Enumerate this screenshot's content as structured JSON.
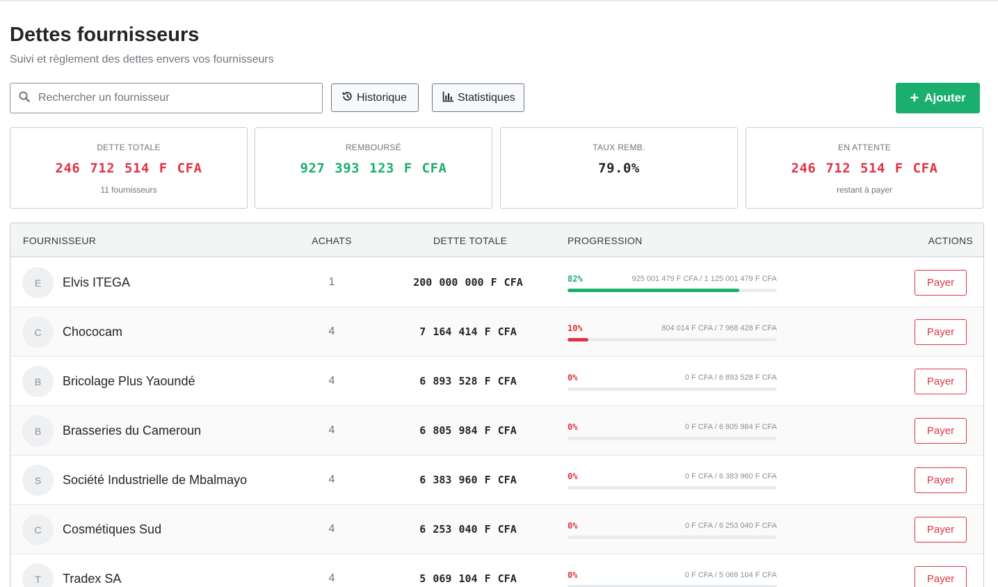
{
  "page": {
    "title": "Dettes fournisseurs",
    "subtitle": "Suivi et règlement des dettes envers vos fournisseurs"
  },
  "toolbar": {
    "search_placeholder": "Rechercher un fournisseur",
    "history_label": "Historique",
    "stats_label": "Statistiques",
    "add_label": "Ajouter"
  },
  "cards": [
    {
      "label": "DETTE TOTALE",
      "value": "246 712 514 F CFA",
      "sub": "11 fournisseurs",
      "color": "#dc3545"
    },
    {
      "label": "REMBOURSÉ",
      "value": "927 393 123 F CFA",
      "sub": "",
      "color": "#1aaf6e"
    },
    {
      "label": "TAUX REMB.",
      "value": "79.0%",
      "sub": "",
      "color": "#212529"
    },
    {
      "label": "EN ATTENTE",
      "value": "246 712 514 F CFA",
      "sub": "restant à payer",
      "color": "#dc3545"
    }
  ],
  "table": {
    "headers": {
      "fournisseur": "FOURNISSEUR",
      "achats": "ACHATS",
      "dette": "DETTE TOTALE",
      "progression": "PROGRESSION",
      "actions": "ACTIONS"
    },
    "pay_label": "Payer",
    "rows": [
      {
        "initial": "E",
        "name": "Elvis ITEGA",
        "achats": "1",
        "dette": "200 000 000 F CFA",
        "pct_label": "82%",
        "progress": 0.82,
        "ratio": "925 001 479 F CFA / 1 125 001 479 F CFA"
      },
      {
        "initial": "C",
        "name": "Chococam",
        "achats": "4",
        "dette": "7 164 414 F CFA",
        "pct_label": "10%",
        "progress": 0.1,
        "ratio": "804 014 F CFA / 7 968 428 F CFA"
      },
      {
        "initial": "B",
        "name": "Bricolage Plus Yaoundé",
        "achats": "4",
        "dette": "6 893 528 F CFA",
        "pct_label": "0%",
        "progress": 0,
        "ratio": "0 F CFA / 6 893 528 F CFA"
      },
      {
        "initial": "B",
        "name": "Brasseries du Cameroun",
        "achats": "4",
        "dette": "6 805 984 F CFA",
        "pct_label": "0%",
        "progress": 0,
        "ratio": "0 F CFA / 6 805 984 F CFA"
      },
      {
        "initial": "S",
        "name": "Société Industrielle de Mbalmayo",
        "achats": "4",
        "dette": "6 383 960 F CFA",
        "pct_label": "0%",
        "progress": 0,
        "ratio": "0 F CFA / 6 383 960 F CFA"
      },
      {
        "initial": "C",
        "name": "Cosmétiques Sud",
        "achats": "4",
        "dette": "6 253 040 F CFA",
        "pct_label": "0%",
        "progress": 0,
        "ratio": "0 F CFA / 6 253 040 F CFA"
      },
      {
        "initial": "T",
        "name": "Tradex SA",
        "achats": "4",
        "dette": "5 069 104 F CFA",
        "pct_label": "0%",
        "progress": 0,
        "ratio": "0 F CFA / 5 069 104 F CFA"
      }
    ]
  },
  "colors": {
    "accent_green": "#1aaf6e",
    "danger_red": "#dc3545"
  }
}
